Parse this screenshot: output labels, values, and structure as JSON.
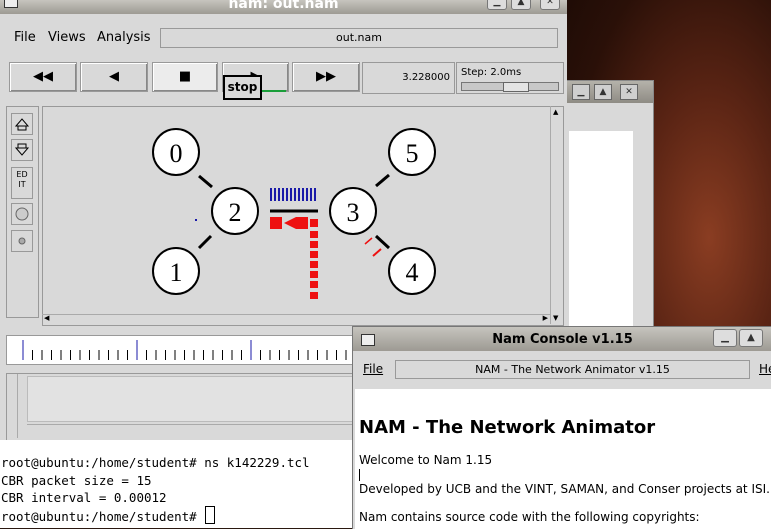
{
  "nam_window": {
    "title": "nam: out.nam",
    "menus": [
      "File",
      "Views",
      "Analysis"
    ],
    "file_name": "out.nam",
    "controls": {
      "rewind": "◀◀",
      "back": "◀",
      "stop": "■",
      "play": "▶",
      "fast_forward": "▶▶"
    },
    "tooltip": "stop",
    "sim_time": "3.228000",
    "step_label": "Step: 2.0ms",
    "tools": {
      "edit": "ED\nIT"
    }
  },
  "topology": {
    "nodes": [
      "0",
      "1",
      "2",
      "3",
      "4",
      "5"
    ]
  },
  "terminal": {
    "lines": [
      "root@ubuntu:/home/student# ns k142229.tcl",
      "CBR packet size = 15",
      "CBR interval = 0.00012",
      "root@ubuntu:/home/student# "
    ]
  },
  "console": {
    "title": "Nam Console v1.15",
    "menu_file": "File",
    "header_text": "NAM - The Network Animator v1.15",
    "help_partial": "He",
    "heading": "NAM - The Network Animator",
    "para1": "Welcome to Nam 1.15",
    "para2": "Developed by UCB and the VINT, SAMAN, and Conser projects at ISI.",
    "para3": "Nam contains source code with the following copyrights:"
  },
  "colors": {
    "packet_red": "#ee1111",
    "packet_blue": "#1a1aa8",
    "progress_green": "#1a9e3a"
  }
}
